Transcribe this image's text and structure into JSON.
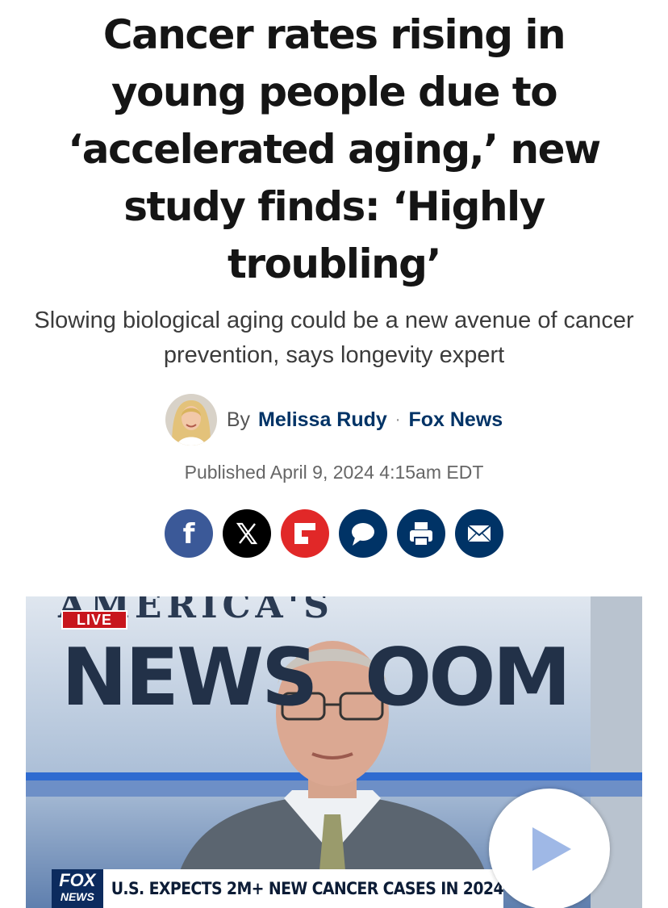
{
  "article": {
    "headline": "Cancer rates rising in young people due to ‘accelerated aging,’ new study finds: ‘Highly troubling’",
    "subheadline": "Slowing biological aging could be a new avenue of cancer prevention, says longevity expert",
    "byline": {
      "prefix": "By",
      "author": "Melissa Rudy",
      "separator": "·",
      "source": "Fox News"
    },
    "published": "Published April 9, 2024 4:15am EDT"
  },
  "share": {
    "buttons": [
      {
        "icon": "facebook-icon",
        "color": "#3b5998"
      },
      {
        "icon": "x-icon",
        "color": "#000000"
      },
      {
        "icon": "flipboard-icon",
        "color": "#e12828"
      },
      {
        "icon": "comment-icon",
        "color": "#003366"
      },
      {
        "icon": "print-icon",
        "color": "#003366"
      },
      {
        "icon": "email-icon",
        "color": "#003366"
      }
    ]
  },
  "video": {
    "live_badge": "LIVE",
    "show_title_top": "AMERICA'S",
    "show_title_left": "NEWS",
    "show_title_right": "OOM",
    "logo_top": "FOX",
    "logo_bottom": "NEWS",
    "ticker": "U.S. EXPECTS 2M+ NEW CANCER CASES IN 2024",
    "play_icon": "play-icon"
  },
  "colors": {
    "link": "#003366",
    "live": "#c8161d",
    "fox_blue": "#0c2b5e"
  }
}
